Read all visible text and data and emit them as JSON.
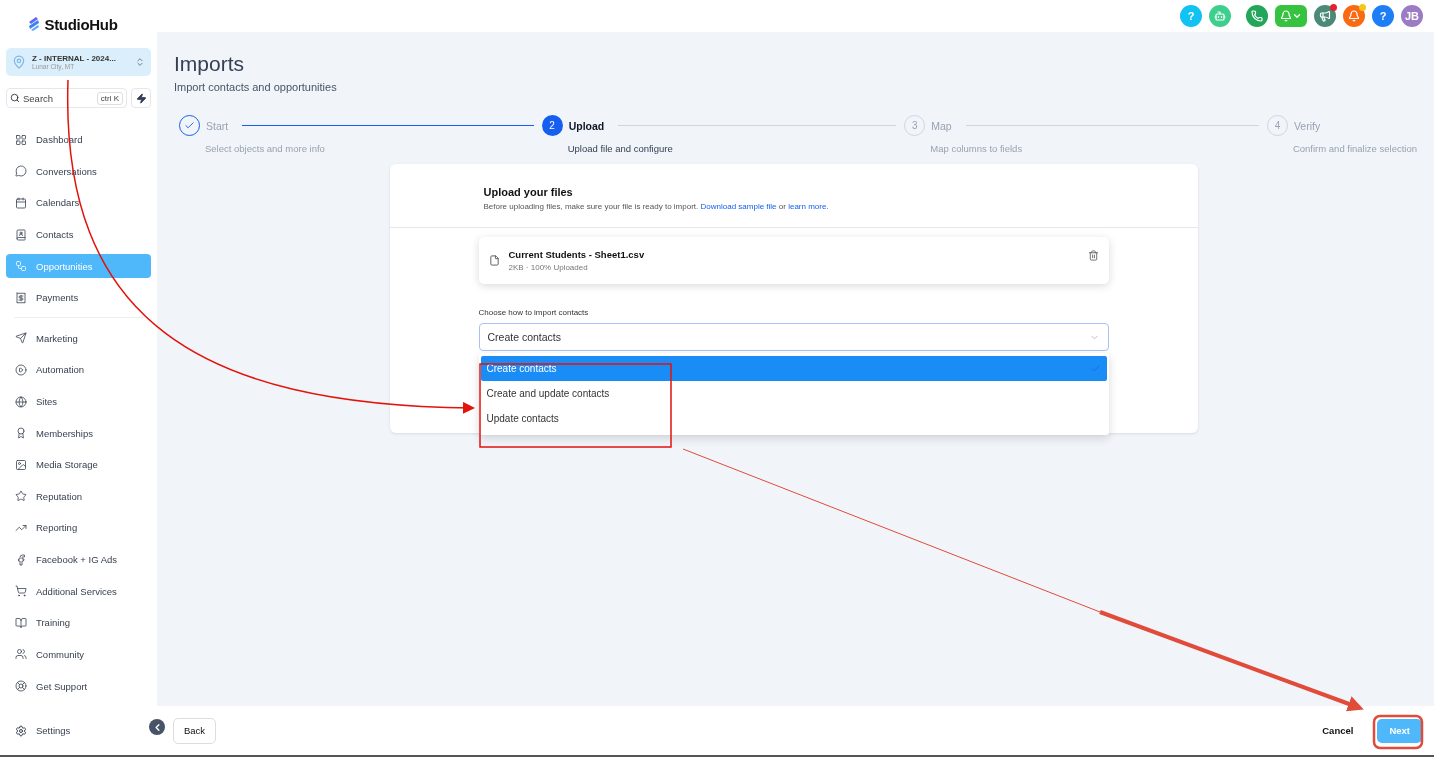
{
  "brand": {
    "name": "StudioHub"
  },
  "header": {
    "buttons": [
      {
        "kind": "help",
        "glyph": "?"
      },
      {
        "kind": "bot"
      },
      {
        "kind": "phone"
      },
      {
        "kind": "bell-menu"
      },
      {
        "kind": "megaphone",
        "dot": true
      },
      {
        "kind": "alert",
        "dot": true
      },
      {
        "kind": "help-blue",
        "glyph": "?"
      },
      {
        "kind": "avatar",
        "glyph": "JB"
      }
    ]
  },
  "workspace": {
    "name": "Z - INTERNAL - 2024...",
    "location": "Lunar City, MT"
  },
  "search": {
    "placeholder": "Search",
    "shortcut": "ctrl K"
  },
  "sidebar": {
    "groups": [
      {
        "items": [
          {
            "label": "Dashboard",
            "selected": false
          },
          {
            "label": "Conversations",
            "selected": false
          },
          {
            "label": "Calendars",
            "selected": false
          },
          {
            "label": "Contacts",
            "selected": false
          },
          {
            "label": "Opportunities",
            "selected": true
          },
          {
            "label": "Payments",
            "selected": false
          }
        ]
      },
      {
        "items": [
          {
            "label": "Marketing",
            "selected": false
          },
          {
            "label": "Automation",
            "selected": false
          },
          {
            "label": "Sites",
            "selected": false
          },
          {
            "label": "Memberships",
            "selected": false
          },
          {
            "label": "Media Storage",
            "selected": false
          },
          {
            "label": "Reputation",
            "selected": false
          },
          {
            "label": "Reporting",
            "selected": false
          },
          {
            "label": "Facebook + IG Ads",
            "selected": false
          },
          {
            "label": "Additional Services",
            "selected": false
          },
          {
            "label": "Training",
            "selected": false
          },
          {
            "label": "Community",
            "selected": false
          },
          {
            "label": "Get Support",
            "selected": false
          }
        ]
      }
    ],
    "settings": "Settings"
  },
  "page": {
    "title": "Imports",
    "subtitle": "Import contacts and opportunities"
  },
  "steps": [
    {
      "title": "Start",
      "subtitle": "Select objects and more info",
      "done": true,
      "selected": false
    },
    {
      "number": "2",
      "title": "Upload",
      "subtitle": "Upload file and configure",
      "done": false,
      "selected": true
    },
    {
      "number": "3",
      "title": "Map",
      "subtitle": "Map columns to fields",
      "done": false,
      "selected": false
    },
    {
      "number": "4",
      "title": "Verify",
      "subtitle": "Confirm and finalize selection",
      "done": false,
      "selected": false
    }
  ],
  "upload": {
    "title": "Upload your files",
    "intro": "Before uploading files, make sure your file is ready to import.",
    "link_sample": "Download sample file",
    "joiner": "or",
    "link_more": "learn more.",
    "file": {
      "name": "Current Students - Sheet1.csv",
      "meta": "2KB · 100% Uploaded"
    },
    "select_label": "Choose how to import contacts",
    "select_value": "Create contacts",
    "options": [
      {
        "label": "Create contacts",
        "selected": true
      },
      {
        "label": "Create and update contacts",
        "selected": false
      },
      {
        "label": "Update contacts",
        "selected": false
      }
    ]
  },
  "footer": {
    "back": "Back",
    "cancel": "Cancel",
    "next": "Next"
  }
}
